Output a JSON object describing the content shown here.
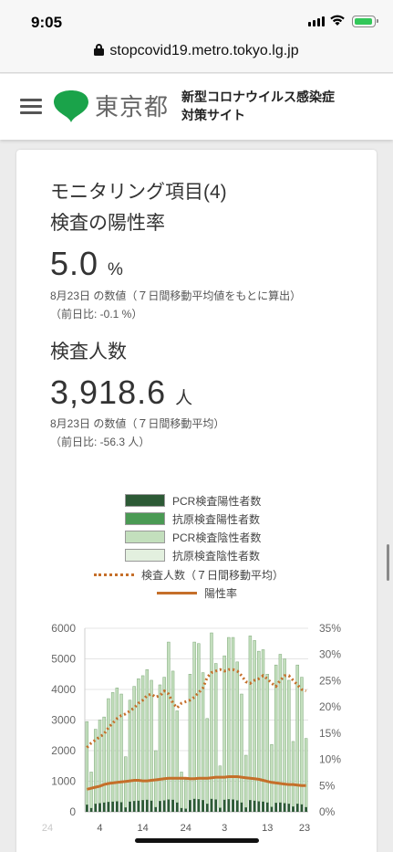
{
  "status_bar": {
    "time": "9:05"
  },
  "browser": {
    "url": "stopcovid19.metro.tokyo.lg.jp"
  },
  "header": {
    "logo_text": "東京都",
    "site_title_line1": "新型コロナウイルス感染症",
    "site_title_line2": "対策サイト"
  },
  "card": {
    "section_title": "モニタリング項目(4)",
    "positivity": {
      "title": "検査の陽性率",
      "value": "5.0",
      "unit": "%",
      "note": "8月23日 の数値（７日間移動平均値をもとに算出）",
      "diff": "（前日比: -0.1 %）"
    },
    "tested": {
      "title": "検査人数",
      "value": "3,918.6",
      "unit": "人",
      "note": "8月23日 の数値（７日間移動平均）",
      "diff": "（前日比: -56.3 人）"
    }
  },
  "colors": {
    "pcr_positive": "#2d5a36",
    "antigen_positive": "#4a9a54",
    "pcr_negative": "#c3dfbd",
    "antigen_negative": "#e3f0df",
    "moving_average": "#c56f2a",
    "positivity_rate": "#c56f2a"
  },
  "chart_data": {
    "type": "bar",
    "legend": [
      {
        "name": "PCR検査陽性者数",
        "style": "bar",
        "color": "#2d5a36"
      },
      {
        "name": "抗原検査陽性者数",
        "style": "bar",
        "color": "#4a9a54"
      },
      {
        "name": "PCR検査陰性者数",
        "style": "bar",
        "color": "#c3dfbd"
      },
      {
        "name": "抗原検査陰性者数",
        "style": "bar",
        "color": "#e3f0df"
      },
      {
        "name": "検査人数（７日間移動平均）",
        "style": "dotted-line",
        "color": "#c56f2a"
      },
      {
        "name": "陽性率",
        "style": "line",
        "color": "#c56f2a"
      }
    ],
    "x_tick_labels": [
      "24",
      "4",
      "14",
      "24",
      "3",
      "13",
      "23"
    ],
    "y_left": {
      "ticks": [
        "0",
        "1000",
        "2000",
        "3000",
        "4000",
        "5000",
        "6000"
      ],
      "range": [
        0,
        6000
      ]
    },
    "y_right": {
      "ticks": [
        "0%",
        "5%",
        "10%",
        "15%",
        "20%",
        "25%",
        "30%",
        "35%"
      ],
      "range": [
        0,
        35
      ]
    },
    "days": 52,
    "total_tested": [
      2950,
      1300,
      2700,
      3000,
      3100,
      3700,
      3900,
      4050,
      3850,
      1800,
      3650,
      4100,
      4350,
      4450,
      4650,
      4300,
      2000,
      4150,
      4400,
      5550,
      4600,
      3300,
      1300,
      1050,
      4500,
      5550,
      5500,
      4550,
      3050,
      5850,
      4850,
      1500,
      5100,
      5700,
      5700,
      4900,
      3850,
      1850,
      5750,
      5600,
      5250,
      5300,
      4500,
      2200,
      4800,
      5150,
      5000,
      4300,
      2300,
      4800,
      4400,
      2400
    ],
    "positives": [
      230,
      120,
      260,
      280,
      300,
      320,
      330,
      340,
      310,
      140,
      330,
      350,
      360,
      380,
      390,
      360,
      150,
      350,
      370,
      400,
      390,
      300,
      120,
      100,
      380,
      420,
      410,
      380,
      260,
      420,
      400,
      130,
      390,
      410,
      400,
      370,
      300,
      140,
      380,
      360,
      340,
      330,
      300,
      160,
      290,
      300,
      280,
      260,
      170,
      260,
      240,
      150
    ],
    "moving_average": [
      2100,
      2250,
      2350,
      2450,
      2550,
      2750,
      2900,
      3050,
      3150,
      3200,
      3300,
      3400,
      3550,
      3650,
      3800,
      3850,
      3750,
      3800,
      3950,
      3850,
      3550,
      3400,
      3550,
      3600,
      3650,
      3750,
      3900,
      4050,
      4400,
      4550,
      4600,
      4650,
      4600,
      4650,
      4650,
      4600,
      4450,
      4250,
      4200,
      4300,
      4350,
      4450,
      4350,
      4200,
      4100,
      4300,
      4450,
      4450,
      4300,
      4150,
      4000,
      3950
    ],
    "positivity_rate": [
      4.3,
      4.5,
      4.7,
      4.9,
      5.2,
      5.4,
      5.5,
      5.6,
      5.7,
      5.8,
      5.9,
      6.0,
      6.0,
      5.9,
      5.9,
      6.0,
      6.1,
      6.2,
      6.3,
      6.4,
      6.4,
      6.4,
      6.4,
      6.4,
      6.3,
      6.3,
      6.4,
      6.4,
      6.4,
      6.5,
      6.6,
      6.6,
      6.6,
      6.7,
      6.7,
      6.7,
      6.6,
      6.5,
      6.4,
      6.3,
      6.2,
      6.0,
      5.8,
      5.6,
      5.5,
      5.4,
      5.3,
      5.2,
      5.2,
      5.1,
      5.0,
      5.0
    ]
  }
}
